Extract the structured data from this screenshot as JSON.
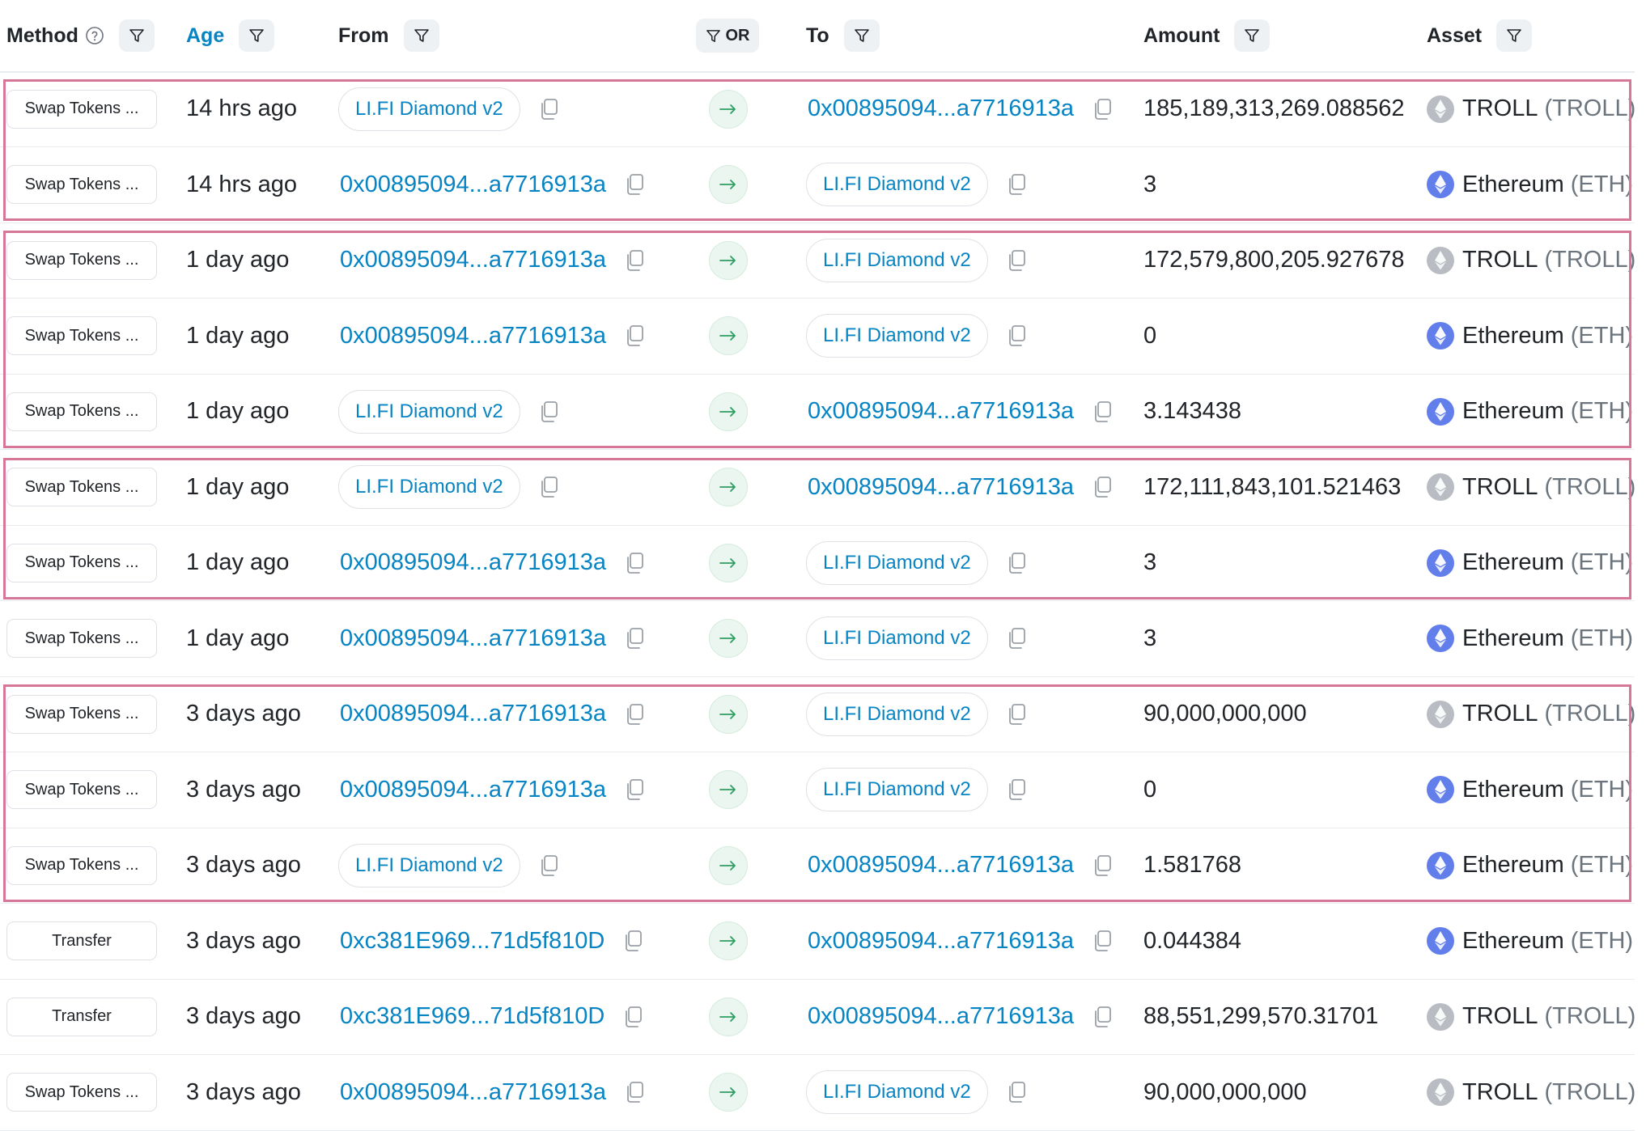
{
  "header": {
    "method": "Method",
    "age": "Age",
    "from": "From",
    "or": "OR",
    "to": "To",
    "amount": "Amount",
    "asset": "Asset"
  },
  "rows": [
    {
      "method": "Swap Tokens ...",
      "age": "14 hrs ago",
      "from": "LI.FI Diamond v2",
      "from_type": "contract",
      "to": "0x00895094...a7716913a",
      "to_type": "address",
      "amount": "185,189,313,269.088562",
      "asset": "TROLL",
      "symbol": "(TROLL)",
      "icon": "troll-token-icon"
    },
    {
      "method": "Swap Tokens ...",
      "age": "14 hrs ago",
      "from": "0x00895094...a7716913a",
      "from_type": "address",
      "to": "LI.FI Diamond v2",
      "to_type": "contract",
      "amount": "3",
      "asset": "Ethereum",
      "symbol": "(ETH)",
      "icon": "ethereum-icon"
    },
    {
      "method": "Swap Tokens ...",
      "age": "1 day ago",
      "from": "0x00895094...a7716913a",
      "from_type": "address",
      "to": "LI.FI Diamond v2",
      "to_type": "contract",
      "amount": "172,579,800,205.927678",
      "asset": "TROLL",
      "symbol": "(TROLL)",
      "icon": "troll-token-icon"
    },
    {
      "method": "Swap Tokens ...",
      "age": "1 day ago",
      "from": "0x00895094...a7716913a",
      "from_type": "address",
      "to": "LI.FI Diamond v2",
      "to_type": "contract",
      "amount": "0",
      "asset": "Ethereum",
      "symbol": "(ETH)",
      "icon": "ethereum-icon"
    },
    {
      "method": "Swap Tokens ...",
      "age": "1 day ago",
      "from": "LI.FI Diamond v2",
      "from_type": "contract",
      "to": "0x00895094...a7716913a",
      "to_type": "address",
      "amount": "3.143438",
      "asset": "Ethereum",
      "symbol": "(ETH)",
      "icon": "ethereum-icon"
    },
    {
      "method": "Swap Tokens ...",
      "age": "1 day ago",
      "from": "LI.FI Diamond v2",
      "from_type": "contract",
      "to": "0x00895094...a7716913a",
      "to_type": "address",
      "amount": "172,111,843,101.521463",
      "asset": "TROLL",
      "symbol": "(TROLL)",
      "icon": "troll-token-icon"
    },
    {
      "method": "Swap Tokens ...",
      "age": "1 day ago",
      "from": "0x00895094...a7716913a",
      "from_type": "address",
      "to": "LI.FI Diamond v2",
      "to_type": "contract",
      "amount": "3",
      "asset": "Ethereum",
      "symbol": "(ETH)",
      "icon": "ethereum-icon"
    },
    {
      "method": "Swap Tokens ...",
      "age": "1 day ago",
      "from": "0x00895094...a7716913a",
      "from_type": "address",
      "to": "LI.FI Diamond v2",
      "to_type": "contract",
      "amount": "3",
      "asset": "Ethereum",
      "symbol": "(ETH)",
      "icon": "ethereum-icon"
    },
    {
      "method": "Swap Tokens ...",
      "age": "3 days ago",
      "from": "0x00895094...a7716913a",
      "from_type": "address",
      "to": "LI.FI Diamond v2",
      "to_type": "contract",
      "amount": "90,000,000,000",
      "asset": "TROLL",
      "symbol": "(TROLL)",
      "icon": "troll-token-icon"
    },
    {
      "method": "Swap Tokens ...",
      "age": "3 days ago",
      "from": "0x00895094...a7716913a",
      "from_type": "address",
      "to": "LI.FI Diamond v2",
      "to_type": "contract",
      "amount": "0",
      "asset": "Ethereum",
      "symbol": "(ETH)",
      "icon": "ethereum-icon"
    },
    {
      "method": "Swap Tokens ...",
      "age": "3 days ago",
      "from": "LI.FI Diamond v2",
      "from_type": "contract",
      "to": "0x00895094...a7716913a",
      "to_type": "address",
      "amount": "1.581768",
      "asset": "Ethereum",
      "symbol": "(ETH)",
      "icon": "ethereum-icon"
    },
    {
      "method": "Transfer",
      "age": "3 days ago",
      "from": "0xc381E969...71d5f810D",
      "from_type": "address",
      "to": "0x00895094...a7716913a",
      "to_type": "address",
      "amount": "0.044384",
      "asset": "Ethereum",
      "symbol": "(ETH)",
      "icon": "ethereum-icon"
    },
    {
      "method": "Transfer",
      "age": "3 days ago",
      "from": "0xc381E969...71d5f810D",
      "from_type": "address",
      "to": "0x00895094...a7716913a",
      "to_type": "address",
      "amount": "88,551,299,570.31701",
      "asset": "TROLL",
      "symbol": "(TROLL)",
      "icon": "troll-token-icon"
    },
    {
      "method": "Swap Tokens ...",
      "age": "3 days ago",
      "from": "0x00895094...a7716913a",
      "from_type": "address",
      "to": "LI.FI Diamond v2",
      "to_type": "contract",
      "amount": "90,000,000,000",
      "asset": "TROLL",
      "symbol": "(TROLL)",
      "icon": "troll-token-icon"
    }
  ],
  "highlight_groups": [
    {
      "first_row": 1,
      "last_row": 2
    },
    {
      "first_row": 3,
      "last_row": 5
    },
    {
      "first_row": 6,
      "last_row": 7
    },
    {
      "first_row": 9,
      "last_row": 11
    }
  ],
  "colors": {
    "link": "#0784c3",
    "highlight_border": "#d6779a",
    "eth_icon": "#627eea",
    "troll_icon": "#b9bdc3"
  }
}
